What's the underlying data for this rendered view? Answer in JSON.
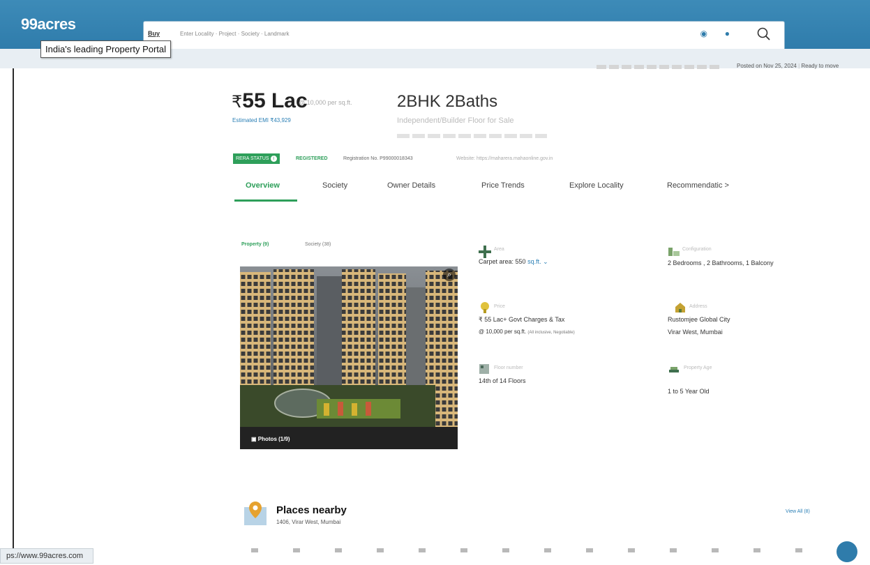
{
  "header": {
    "logo": "99acres",
    "logo_tooltip": "India's leading Property Portal",
    "search": {
      "buy_dropdown": "Buy",
      "placeholder": "Enter Locality · Project · Society · Landmark"
    },
    "posted_on": "Posted on Nov 25, 2024",
    "status": "Ready to move"
  },
  "listing": {
    "price": "55 Lac",
    "price_symbol": "₹",
    "price_per_sqft": "@ 10,000 per sq.ft.",
    "emi": "Estimated EMI ₹43,929",
    "title": "2BHK 2Baths",
    "subtitle": "Independent/Builder Floor for Sale",
    "rera": {
      "badge": "RERA STATUS",
      "status": "REGISTERED",
      "registration": "Registration No. P99000018343"
    }
  },
  "tabs": [
    {
      "label": "Overview"
    },
    {
      "label": "Society"
    },
    {
      "label": "Owner Details"
    },
    {
      "label": "Price Trends"
    },
    {
      "label": "Explore Locality"
    },
    {
      "label": "Recommendatic >"
    }
  ],
  "gallery": {
    "tab_property": "Property (9)",
    "tab_society": "Society (38)",
    "photos_count": "Photos (1/9)"
  },
  "details": {
    "area": {
      "label": "Area",
      "value": "Carpet area: 550",
      "unit": "sq.ft."
    },
    "config": {
      "label": "Configuration",
      "value": "2 Bedrooms , 2 Bathrooms, 1 Balcony"
    },
    "price": {
      "label": "Price",
      "value": "₹ 55 Lac+ Govt Charges & Tax",
      "sub": "@ 10,000 per sq.ft.",
      "sub_note": "(All inclusive, Negotiable)"
    },
    "address": {
      "label": "Address",
      "line1": "Rustomjee Global City",
      "line2": "Virar West, Mumbai"
    },
    "floor": {
      "label": "Floor number",
      "value": "14th of 14 Floors"
    },
    "age": {
      "label": "Property Age",
      "value": "1 to 5 Year Old"
    }
  },
  "places": {
    "title": "Places nearby",
    "address": "1406, Virar West, Mumbai",
    "view_all": "View All (8)"
  },
  "status_bar": {
    "url": "ps://www.99acres.com"
  },
  "colors": {
    "brand_blue": "#2f7cab",
    "accent_green": "#2e9f5a"
  }
}
